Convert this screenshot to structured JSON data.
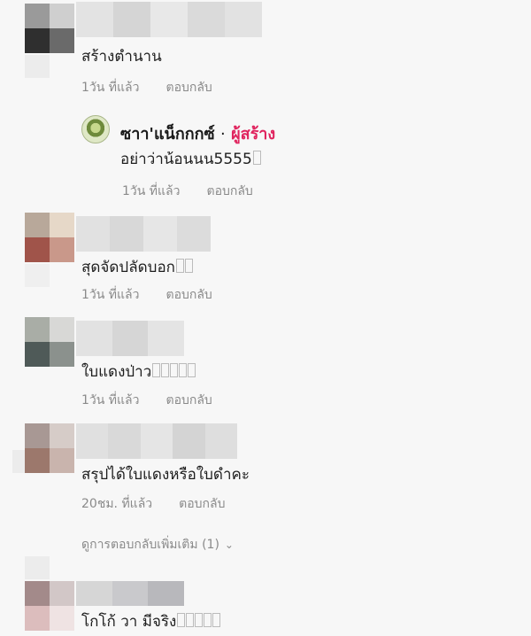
{
  "comments": [
    {
      "text": "สร้างตำนาน",
      "time": "1วัน ที่แล้ว",
      "reply": "ตอบกลับ"
    },
    {
      "text": "สุดจัดปลัดบอก",
      "time": "1วัน ที่แล้ว",
      "reply": "ตอบกลับ"
    },
    {
      "text": "ใบแดงป่าว",
      "time": "1วัน ที่แล้ว",
      "reply": "ตอบกลับ"
    },
    {
      "text": "สรุปได้ใบแดงหรือใบดำคะ",
      "time": "20ชม. ที่แล้ว",
      "reply": "ตอบกลับ"
    },
    {
      "text": "โกโก้ วา มีจริง"
    }
  ],
  "creator_reply": {
    "name": "ซาา'แน็กกกซ์",
    "separator": "·",
    "badge": "ผู้สร้าง",
    "text": "อย่าว่าน้อนนน5555",
    "time": "1วัน ที่แล้ว",
    "reply": "ตอบกลับ"
  },
  "view_more": {
    "label": "ดูการตอบกลับเพิ่มเติม (1)"
  },
  "colors": {
    "creator_badge": "#e0245e",
    "meta_text": "#8a8a8a"
  }
}
